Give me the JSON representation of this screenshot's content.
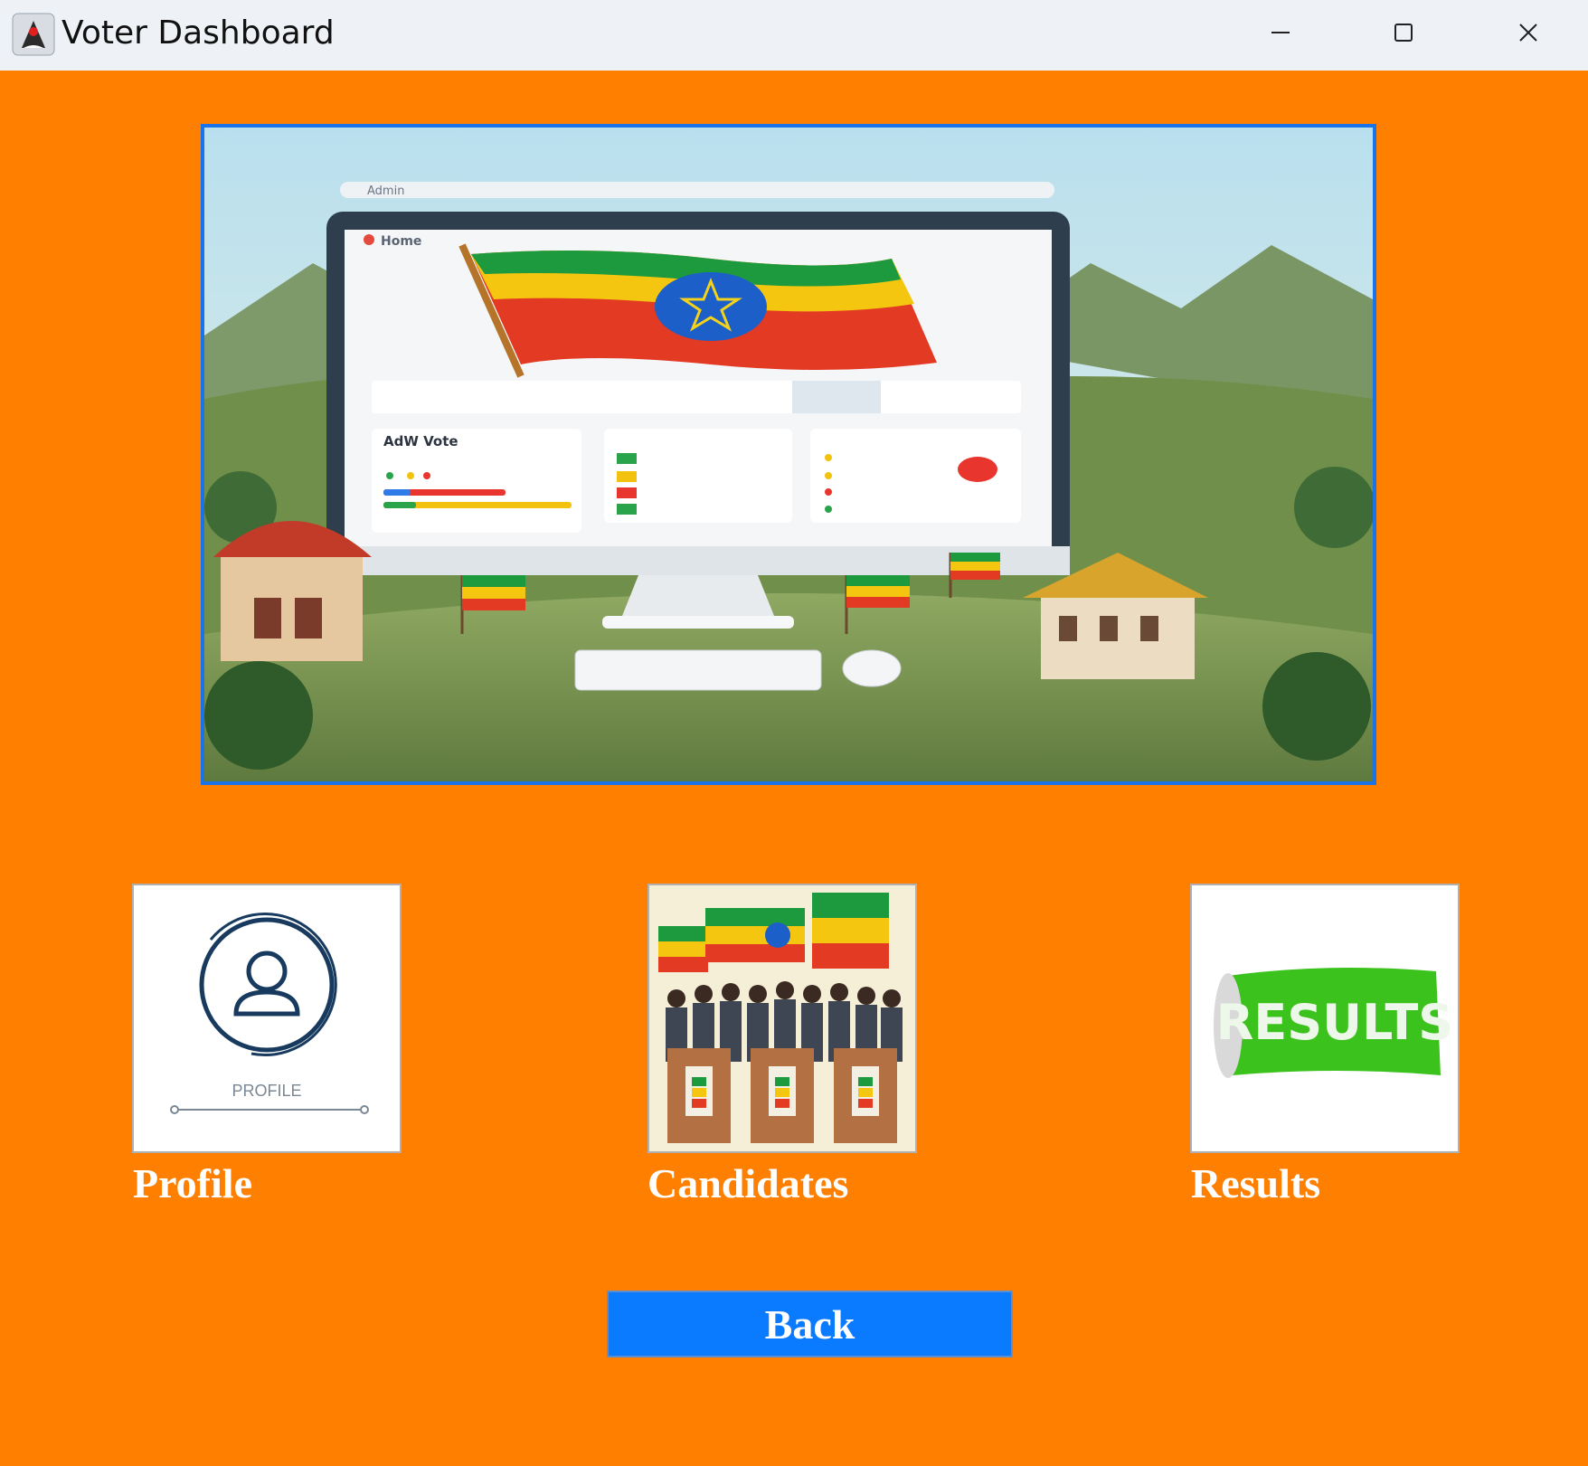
{
  "window": {
    "title": "Voter Dashboard",
    "app_icon": "java-duke-icon",
    "controls": [
      "minimize-icon",
      "maximize-icon",
      "close-icon"
    ]
  },
  "banner": {
    "image": "voting-dashboard-illustration",
    "screen_header": "Home",
    "search_label": "Admin",
    "card_title": "AdW   Vote"
  },
  "tiles": [
    {
      "name": "profile",
      "icon": "profile-icon",
      "caption": "PROFILE",
      "label": "Profile"
    },
    {
      "name": "candidates",
      "icon": "candidates-image",
      "label": "Candidates"
    },
    {
      "name": "results",
      "icon": "results-banner-image",
      "banner_text": "RESULTS",
      "label": "Results"
    }
  ],
  "back_button": {
    "label": "Back"
  },
  "colors": {
    "background": "#ff7f00",
    "button": "#0a7bff",
    "banner_border": "#1a73e8",
    "label": "#ffffff"
  }
}
